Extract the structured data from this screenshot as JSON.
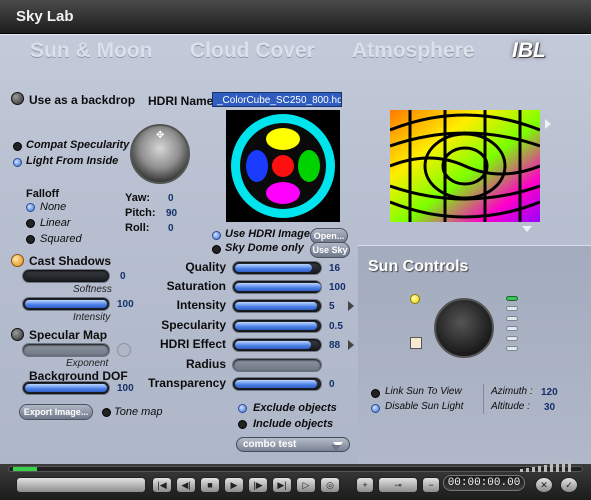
{
  "window": {
    "title": "Sky Lab"
  },
  "tabs": [
    {
      "label": "Sun & Moon",
      "active": false
    },
    {
      "label": "Cloud Cover",
      "active": false
    },
    {
      "label": "Atmosphere",
      "active": false
    },
    {
      "label": "IBL",
      "active": true
    }
  ],
  "ibl": {
    "use_as_backdrop": "Use as a backdrop",
    "hdri_name_label": "HDRI Name",
    "hdri_name_value": "_ColorCube_SC250_800.hd",
    "compat_specularity": "Compat Specularity",
    "light_from_inside": "Light From Inside",
    "falloff": {
      "label": "Falloff",
      "options": [
        "None",
        "Linear",
        "Squared"
      ],
      "selected": "None"
    },
    "yaw": {
      "label": "Yaw:",
      "value": "0"
    },
    "pitch": {
      "label": "Pitch:",
      "value": "90"
    },
    "roll": {
      "label": "Roll:",
      "value": "0"
    },
    "use_hdri_image": "Use HDRI Image",
    "sky_dome_only": "Sky Dome only",
    "open_button": "Open...",
    "use_sky_button": "Use Sky"
  },
  "shadows": {
    "cast_shadows": "Cast Shadows",
    "softness": {
      "caption": "Softness",
      "value": "0",
      "fraction": 0.0
    },
    "intensity": {
      "caption": "Intensity",
      "value": "100",
      "fraction": 1.0
    }
  },
  "specular_map": {
    "label": "Specular Map",
    "exponent_caption": "Exponent",
    "background_dof": "Background DOF",
    "dof_value": "100",
    "dof_fraction": 1.0
  },
  "export_button": "Export Image...",
  "tone_map": "Tone map",
  "params": [
    {
      "label": "Quality",
      "value": "16",
      "fraction": 0.9
    },
    {
      "label": "Saturation",
      "value": "100",
      "fraction": 1.0
    },
    {
      "label": "Intensity",
      "value": "5",
      "fraction": 0.95
    },
    {
      "label": "Specularity",
      "value": "0.5",
      "fraction": 0.95
    },
    {
      "label": "HDRI Effect",
      "value": "88",
      "fraction": 0.88
    },
    {
      "label": "Radius",
      "value": "",
      "fraction": 0.0
    },
    {
      "label": "Transparency",
      "value": "0",
      "fraction": 0.95
    }
  ],
  "objects": {
    "exclude": "Exclude objects",
    "include": "Include objects",
    "combo_value": "combo test"
  },
  "sun_controls": {
    "title": "Sun Controls",
    "link_sun_to_view": "Link Sun To View",
    "disable_sun_light": "Disable Sun Light",
    "azimuth": {
      "label": "Azimuth :",
      "value": "120"
    },
    "altitude": {
      "label": "Altitude :",
      "value": "30"
    }
  },
  "timeline": {
    "counter": "00:00:00.00"
  },
  "colors": {
    "accent": "#4a7fe6",
    "panel": "#b7bfd0",
    "titlebar": "#2a2a2a"
  }
}
